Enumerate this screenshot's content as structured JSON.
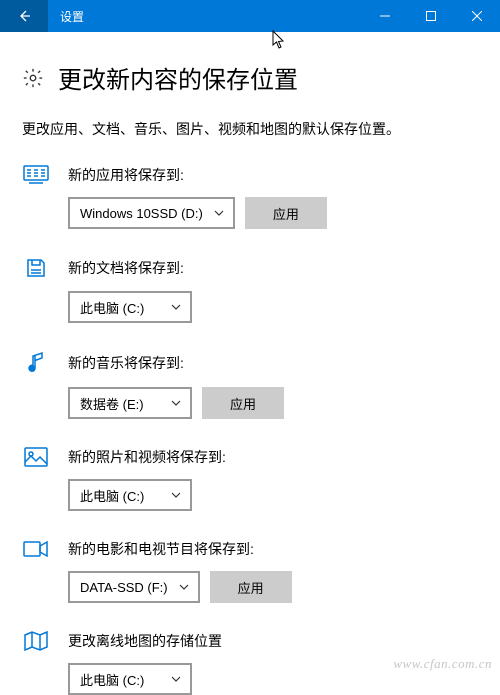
{
  "window": {
    "title": "设置"
  },
  "page": {
    "heading": "更改新内容的保存位置",
    "description": "更改应用、文档、音乐、图片、视频和地图的默认保存位置。"
  },
  "sections": {
    "apps": {
      "label": "新的应用将保存到:",
      "selected": "Windows 10SSD (D:)",
      "apply": "应用"
    },
    "documents": {
      "label": "新的文档将保存到:",
      "selected": "此电脑 (C:)"
    },
    "music": {
      "label": "新的音乐将保存到:",
      "selected": "数据卷 (E:)",
      "apply": "应用"
    },
    "photos": {
      "label": "新的照片和视频将保存到:",
      "selected": "此电脑 (C:)"
    },
    "movies": {
      "label": "新的电影和电视节目将保存到:",
      "selected": "DATA-SSD (F:)",
      "apply": "应用"
    },
    "maps": {
      "label": "更改离线地图的存储位置",
      "selected": "此电脑 (C:)"
    }
  },
  "watermark": "www.cfan.com.cn"
}
